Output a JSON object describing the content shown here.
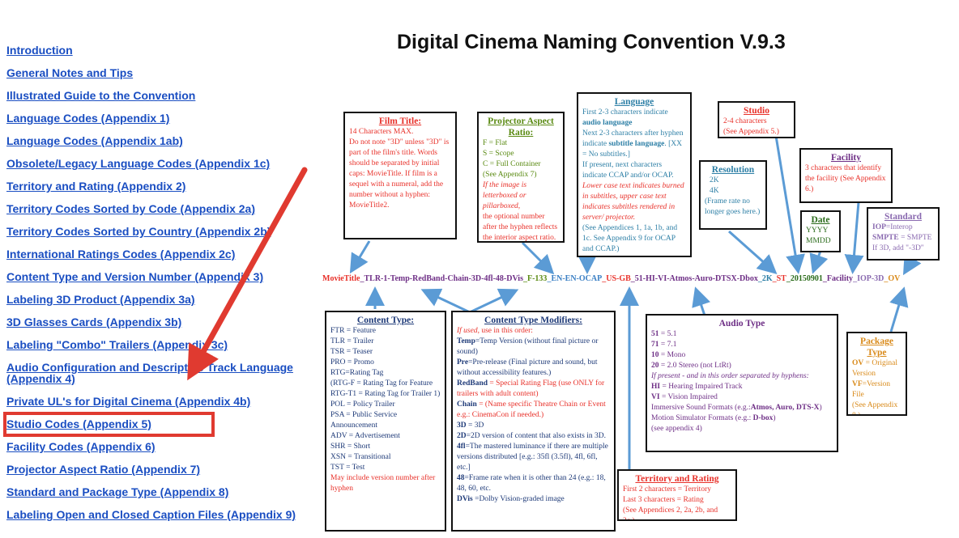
{
  "title": "Digital Cinema Naming Convention V.9.3",
  "nav": [
    "Introduction",
    "General Notes and Tips",
    "Illustrated Guide to the Convention",
    "Language Codes (Appendix 1)",
    "Language Codes  (Appendix 1ab)",
    "Obsolete/Legacy Language Codes (Appendix 1c)",
    "Territory and Rating (Appendix 2)",
    "Territory Codes Sorted by Code (Appendix 2a)",
    "Territory Codes Sorted by Country (Appendix 2b)",
    "International Ratings Codes (Appendix 2c)",
    "Content Type and Version Number (Appendix 3)",
    "Labeling 3D Product (Appendix 3a)",
    "3D Glasses Cards (Appendix 3b)",
    "Labeling \"Combo\" Trailers (Appendix 3c)",
    "Audio Configuration and Descriptive Track Language (Appendix 4)",
    "Private UL's for Digital Cinema (Appendix 4b)",
    "Studio Codes (Appendix 5)",
    "Facility Codes (Appendix 6)",
    "Projector Aspect Ratio (Appendix 7)",
    "Standard and Package Type (Appendix 8)",
    "Labeling Open and Closed Caption Files (Appendix 9)"
  ],
  "highlighted_item": "Studio Codes (Appendix 5)",
  "colors": {
    "link": "#1a4ec2",
    "arrow": "#e03a30",
    "diagram_arrow": "#5b9bd5"
  },
  "diagram": {
    "filename_parts": [
      {
        "text": "MovieTitle",
        "color": "#e8312a"
      },
      {
        "text": "_TLR-1-Temp-RedBand-Chain-3D-4fl-48-DVis",
        "color": "#6e2f86"
      },
      {
        "text": "_F-133",
        "color": "#5a8a12"
      },
      {
        "text": "_EN-EN-OCAP",
        "color": "#3a7fc4"
      },
      {
        "text": "_US-GB",
        "color": "#e8312a"
      },
      {
        "text": "_51-HI-VI-Atmos-Auro-DTSX-Dbox",
        "color": "#6e2f86"
      },
      {
        "text": "_2K",
        "color": "#2d7fa6"
      },
      {
        "text": "_ST",
        "color": "#e8312a"
      },
      {
        "text": "_20150901",
        "color": "#2a6b1a"
      },
      {
        "text": "_Facility",
        "color": "#6e2f86"
      },
      {
        "text": "_IOP-3D",
        "color": "#8a6ab0"
      },
      {
        "text": "_OV",
        "color": "#d98a1a"
      }
    ],
    "film_title": {
      "heading": "Film Title:",
      "lines": [
        "14 Characters MAX.",
        "Do not note \"3D\" unless \"3D\" is part of the film's title. Words should be separated by initial caps: MovieTitle. If film is a sequel with a numeral, add the number without a hyphen: MovieTitle2."
      ]
    },
    "projector": {
      "heading": "Projector Aspect Ratio:",
      "lines": [
        "F = Flat",
        "S = Scope",
        "C = Full Container",
        "(See Appendix 7)"
      ],
      "italic_note": "If the image is letterboxed or pillarboxed,",
      "note": "the optional number after the hyphen reflects the interior aspect ratio."
    },
    "language": {
      "heading": "Language",
      "p1a": "First 2-3 characters indicate ",
      "p1b": "audio language",
      "p2a": "Next 2-3 characters after hyphen indicate ",
      "p2b": "subtitle language",
      "p2c": ". [XX = No subtitles.]",
      "p3": "If present, next characters indicate CCAP and/or OCAP.",
      "p4": "Lower case text indicates burned in subtitles, upper case text indicates subtitles rendered in server/ projector.",
      "p5": "(See Appendices 1, 1a, 1b, and 1c. See Appendix 9 for OCAP and CCAP.)"
    },
    "resolution": {
      "heading": "Resolution",
      "lines": [
        "2K",
        "4K"
      ],
      "note": "(Frame rate no longer goes here.)"
    },
    "studio": {
      "heading": "Studio",
      "lines": [
        "2-4 characters",
        "(See Appendix 5.)"
      ]
    },
    "facility": {
      "heading": "Facility",
      "text": "3 characters that identify the facility (See Appendix 6.)"
    },
    "date": {
      "heading": "Date",
      "lines": [
        "YYYY",
        "MMDD"
      ]
    },
    "standard": {
      "heading": "Standard",
      "l1a": "IOP",
      "l1b": "=Interop",
      "l2a": "SMPTE",
      "l2b": " = SMPTE",
      "l3": "If 3D, add \"-3D\""
    },
    "content_type": {
      "heading": "Content Type:",
      "lines": [
        "FTR = Feature",
        "TLR = Trailer",
        "TSR = Teaser",
        "PRO = Promo",
        "RTG=Rating Tag",
        "(RTG-F = Rating Tag for Feature",
        "RTG-T1 = Rating Tag for Trailer 1)",
        "POL = Policy Trailer",
        "PSA = Public Service Announcement",
        "ADV = Advertisement",
        "SHR = Short",
        "XSN = Transitional",
        "TST = Test"
      ],
      "note": "May include version number after hyphen"
    },
    "modifiers": {
      "heading": "Content Type Modifiers:",
      "intro_a": "If used",
      "intro_b": ", use in this order:",
      "items": [
        {
          "k": "Temp",
          "v": "=Temp Version (without final picture or sound)"
        },
        {
          "k": "Pre",
          "v": "=Pre-release (Final picture and sound, but without accessibility features.)"
        },
        {
          "k": "RedBand",
          "v": " = Special Rating Flag (use ONLY for trailers with adult content)"
        },
        {
          "k": "Chain",
          "v": " = (Name specific Theatre Chain or Event e.g.: CinemaCon if needed.)"
        },
        {
          "k": "3D",
          "v": " = 3D"
        },
        {
          "k": "2D",
          "v": "=2D version of content that also exists in 3D."
        },
        {
          "k": "4fl",
          "v": "=The mastered luminance if there are multiple versions distributed [e.g.: 35fl (3.5fl), 4fl, 6fl, etc.]"
        },
        {
          "k": "48",
          "v": "=Frame rate when it is other than 24 (e.g.: 18, 48, 60, etc."
        },
        {
          "k": "DVis",
          "v": " =Dolby Vision-graded image"
        }
      ]
    },
    "audio": {
      "heading": "Audio Type",
      "lines": [
        {
          "k": "51",
          "v": " = 5.1"
        },
        {
          "k": "71",
          "v": " = 7.1"
        },
        {
          "k": "10",
          "v": " = Mono"
        },
        {
          "k": "20",
          "v": " = 2.0 Stereo (not LtRt)"
        }
      ],
      "italic": "If present - and in this order separated by hyphens:",
      "hi_k": "HI",
      "hi_v": " = Hearing Impaired Track",
      "vi_k": "VI",
      "vi_v": " = Vision Impaired",
      "immersive": "Immersive Sound Formats (e.g.:",
      "immersive_b": "Atmos, Auro, DTS-X",
      "immersive_c": ")",
      "motion": "Motion Simulator Formats (e.g.: ",
      "motion_b": "D-box",
      "motion_c": ")",
      "see": "(see appendix 4)"
    },
    "territory": {
      "heading": "Territory and Rating",
      "lines": [
        "First 2 characters = Territory",
        "Last 3 characters = Rating",
        "(See Appendices 2, 2a, 2b, and 2c.)"
      ]
    },
    "package": {
      "heading": "Package Type",
      "l1a": "OV",
      "l1b": " = Original Version",
      "l2a": "VF",
      "l2b": "=Version File",
      "l3": "(See Appendix 8.)"
    }
  }
}
